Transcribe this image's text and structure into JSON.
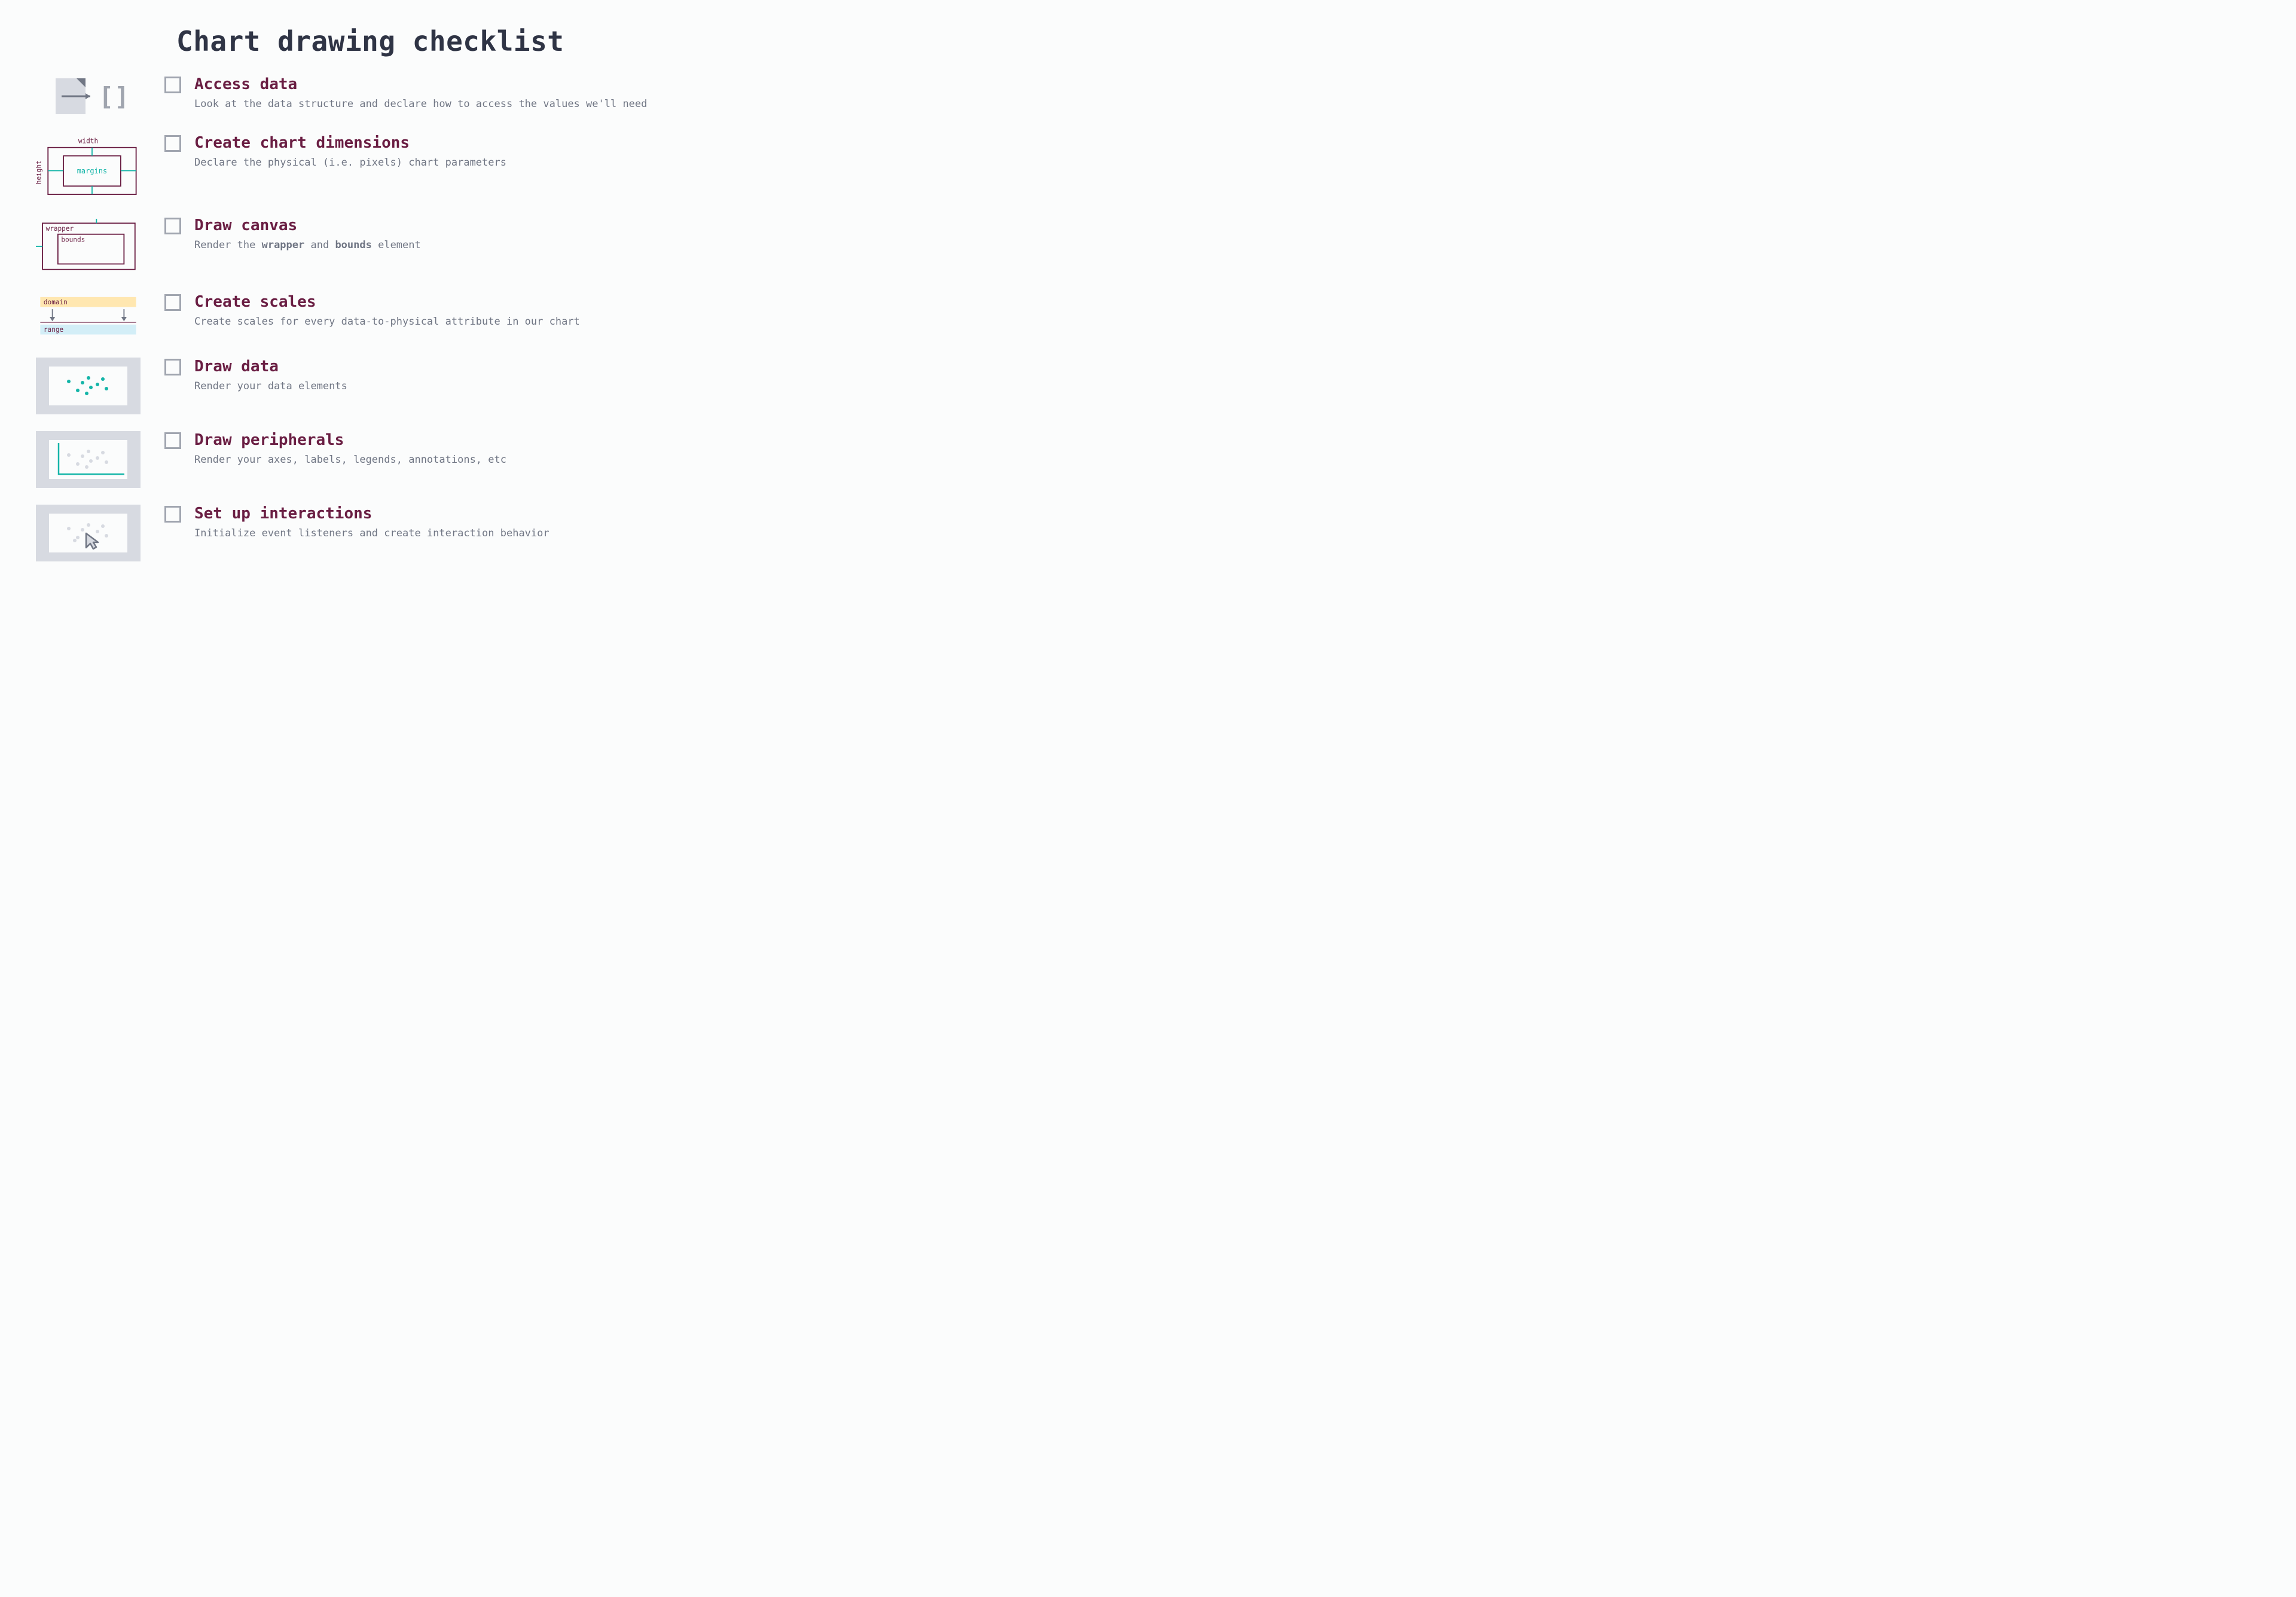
{
  "title": "Chart drawing checklist",
  "steps": [
    {
      "title": "Access data",
      "desc": "Look at the data structure and declare how to access the values we'll need"
    },
    {
      "title": "Create chart dimensions",
      "desc": "Declare the physical (i.e. pixels) chart parameters",
      "labels": {
        "width": "width",
        "height": "height",
        "margins": "margins"
      }
    },
    {
      "title": "Draw canvas",
      "desc": "Render the <b>wrapper</b> and <b>bounds</b> element",
      "labels": {
        "wrapper": "wrapper",
        "bounds": "bounds"
      }
    },
    {
      "title": "Create scales",
      "desc": "Create scales for every data-to-physical attribute in our chart",
      "labels": {
        "domain": "domain",
        "range": "range"
      }
    },
    {
      "title": "Draw data",
      "desc": "Render your data elements"
    },
    {
      "title": "Draw peripherals",
      "desc": "Render your axes, labels, legends, annotations, etc"
    },
    {
      "title": "Set up interactions",
      "desc": "Initialize event listeners and create interaction behavior"
    }
  ]
}
